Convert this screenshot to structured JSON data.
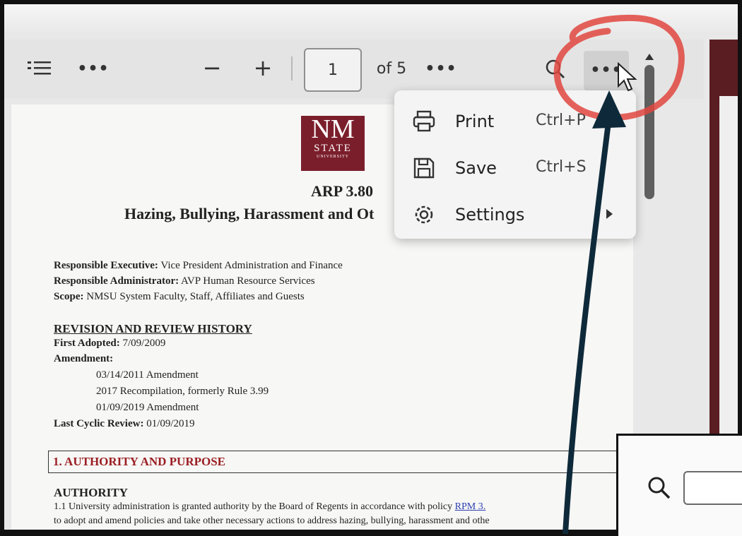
{
  "toolbar": {
    "toc_icon": "table-of-contents-icon",
    "left_more": "•••",
    "zoom_out": "−",
    "zoom_in": "+",
    "page_value": "1",
    "page_total": "of 5",
    "mid_more": "•••",
    "search_icon": "search-icon",
    "more_options": "•••"
  },
  "menu": {
    "items": [
      {
        "label": "Print",
        "shortcut": "Ctrl+P",
        "icon": "printer-icon"
      },
      {
        "label": "Save",
        "shortcut": "Ctrl+S",
        "icon": "save-icon"
      },
      {
        "label": "Settings",
        "shortcut": "",
        "icon": "gear-icon"
      }
    ]
  },
  "document": {
    "logo": {
      "line1": "NM",
      "line2": "STATE",
      "line3": "UNIVERSITY"
    },
    "number": "ARP 3.80",
    "title": "Hazing, Bullying, Harassment and Ot",
    "responsible_executive_label": "Responsible Executive:",
    "responsible_executive_value": "Vice President Administration and Finance",
    "responsible_administrator_label": "Responsible Administrator:",
    "responsible_administrator_value": "AVP Human Resource Services",
    "scope_label": "Scope:",
    "scope_value": "NMSU System Faculty, Staff, Affiliates and Guests",
    "revision_heading": "REVISION AND REVIEW HISTORY",
    "first_adopted_label": "First Adopted:",
    "first_adopted_value": "7/09/2009",
    "amendment_label": "Amendment:",
    "amendments": [
      "03/14/2011 Amendment",
      "2017 Recompilation, formerly Rule 3.99",
      "01/09/2019 Amendment"
    ],
    "last_review_label": "Last Cyclic Review:",
    "last_review_value": "01/09/2019",
    "section_1": "1.  AUTHORITY AND PURPOSE",
    "authority_heading": "AUTHORITY",
    "authority_line1": "1.1 University administration is granted authority by the Board of Regents in accordance with policy",
    "authority_link": "RPM 3.",
    "authority_line2": "to adopt and amend policies and take other necessary actions to address hazing, bullying, harassment and othe"
  },
  "inset": {
    "search_icon": "search-icon",
    "field_value": ""
  },
  "colors": {
    "brand": "#7b1e2b",
    "section_heading": "#9a1f23",
    "link": "#2b3fb0",
    "annotation_circle": "#e0473f",
    "annotation_arrow": "#0e2a3a"
  }
}
